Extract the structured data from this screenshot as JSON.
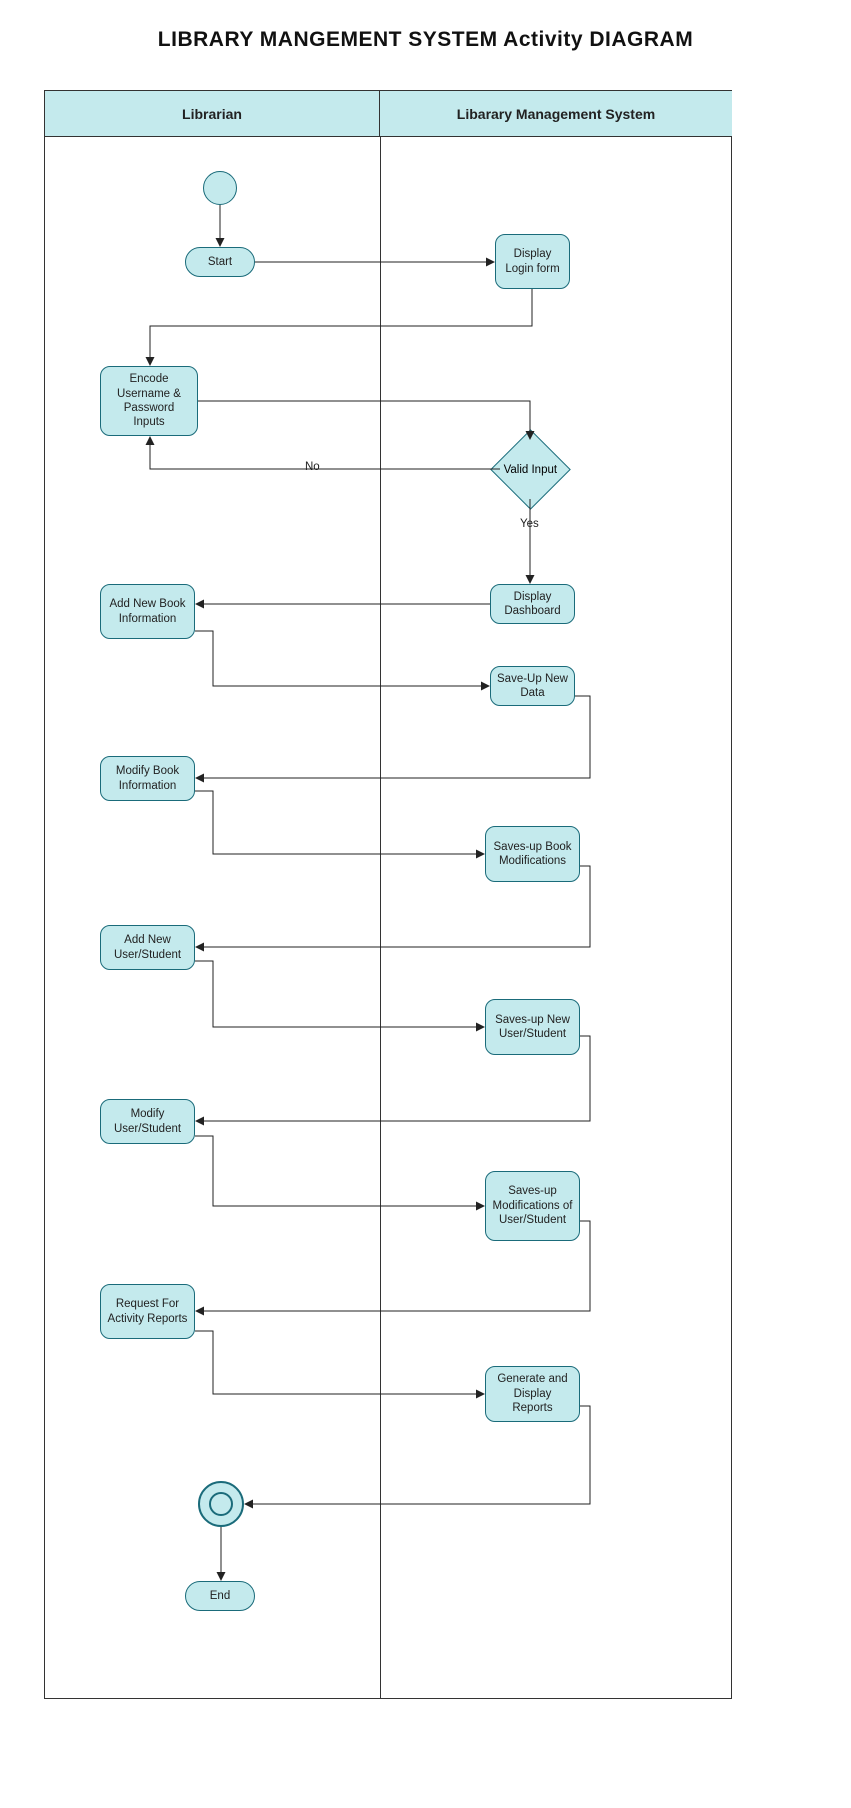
{
  "title": "LIBRARY MANGEMENT SYSTEM Activity DIAGRAM",
  "lanes": {
    "left": "Librarian",
    "right": "Libarary Management System"
  },
  "nodes": {
    "start": "Start",
    "displayLogin": "Display Login form",
    "encode": "Encode Username & Password Inputs",
    "validInput": "Valid Input",
    "displayDashboard": "Display Dashboard",
    "addNewBook": "Add New Book Information",
    "saveNewData": "Save-Up New Data",
    "modifyBook": "Modify Book Information",
    "saveBookMods": "Saves-up Book Modifications",
    "addUser": "Add New User/Student",
    "saveNewUser": "Saves-up New User/Student",
    "modifyUser": "Modify User/Student",
    "saveUserMods": "Saves-up Modifications of User/Student",
    "requestReports": "Request For Activity Reports",
    "generateReports": "Generate and Display Reports",
    "end": "End"
  },
  "edgeLabels": {
    "no": "No",
    "yes": "Yes"
  }
}
